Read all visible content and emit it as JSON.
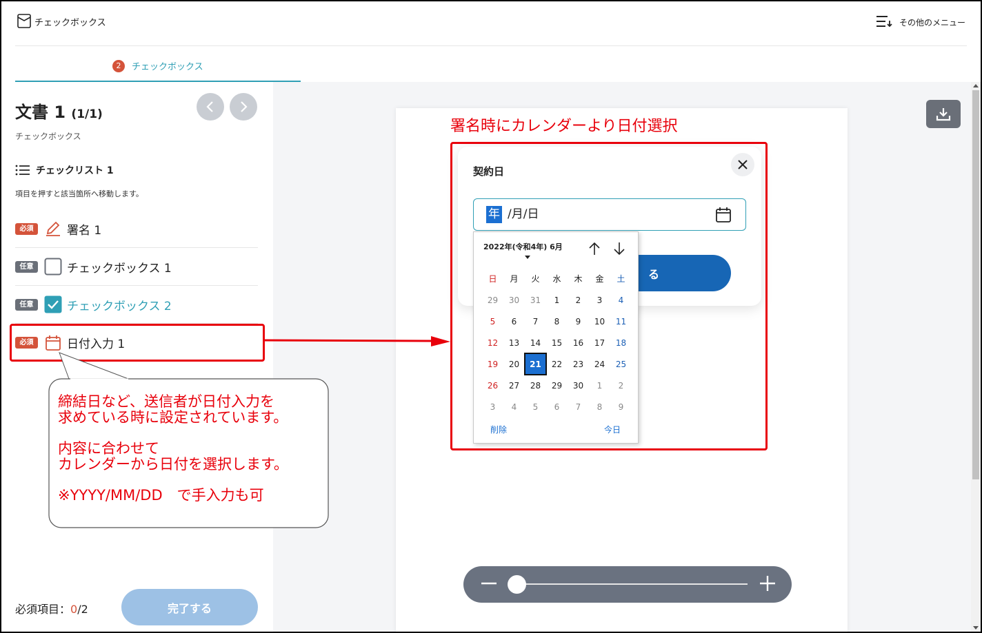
{
  "header": {
    "app_title": "チェックボックス",
    "menu_label": "その他のメニュー"
  },
  "step": {
    "number": "2",
    "label": "チェックボックス"
  },
  "sidebar": {
    "doc_title": "文書 1",
    "doc_page": "(1/1)",
    "doc_subtitle": "チェックボックス",
    "checklist_title": "チェックリスト 1",
    "checklist_note": "項目を押すと該当箇所へ移動します。",
    "items": [
      {
        "badge": "必須",
        "label": "署名 1",
        "icon": "pencil-icon"
      },
      {
        "badge": "任意",
        "label": "チェックボックス 1",
        "icon": "checkbox-empty-icon"
      },
      {
        "badge": "任意",
        "label": "チェックボックス 2",
        "icon": "checkbox-checked-icon"
      },
      {
        "badge": "必須",
        "label": "日付入力 1",
        "icon": "calendar-icon"
      }
    ],
    "required_label": "必須項目：",
    "required_done": "0",
    "required_total": "/2",
    "complete_button": "完了する"
  },
  "modal": {
    "title": "契約日",
    "date_year_segment": "年",
    "date_rest_segments": "/月/日",
    "confirm_partial": "る"
  },
  "calendar": {
    "month_label": "2022年(令和4年) 6月",
    "weekdays": [
      "日",
      "月",
      "火",
      "水",
      "木",
      "金",
      "土"
    ],
    "days": [
      [
        "29",
        "30",
        "31",
        "1",
        "2",
        "3",
        "4"
      ],
      [
        "5",
        "6",
        "7",
        "8",
        "9",
        "10",
        "11"
      ],
      [
        "12",
        "13",
        "14",
        "15",
        "16",
        "17",
        "18"
      ],
      [
        "19",
        "20",
        "21",
        "22",
        "23",
        "24",
        "25"
      ],
      [
        "26",
        "27",
        "28",
        "29",
        "30",
        "1",
        "2"
      ],
      [
        "3",
        "4",
        "5",
        "6",
        "7",
        "8",
        "9"
      ]
    ],
    "selected_day": "21",
    "clear_label": "削除",
    "today_label": "今日"
  },
  "annotations": {
    "title": "署名時にカレンダーより日付選択",
    "callout_lines": [
      "締結日など、送信者が日付入力を",
      "求めている時に設定されています。",
      "",
      "内容に合わせて",
      "カレンダーから日付を選択します。",
      "",
      "※YYYY/MM/DD　で手入力も可"
    ]
  },
  "colors": {
    "accent_teal": "#2f9fb5",
    "required_red": "#d4533a",
    "annotation_red": "#e8000b",
    "primary_blue": "#1766b5"
  }
}
